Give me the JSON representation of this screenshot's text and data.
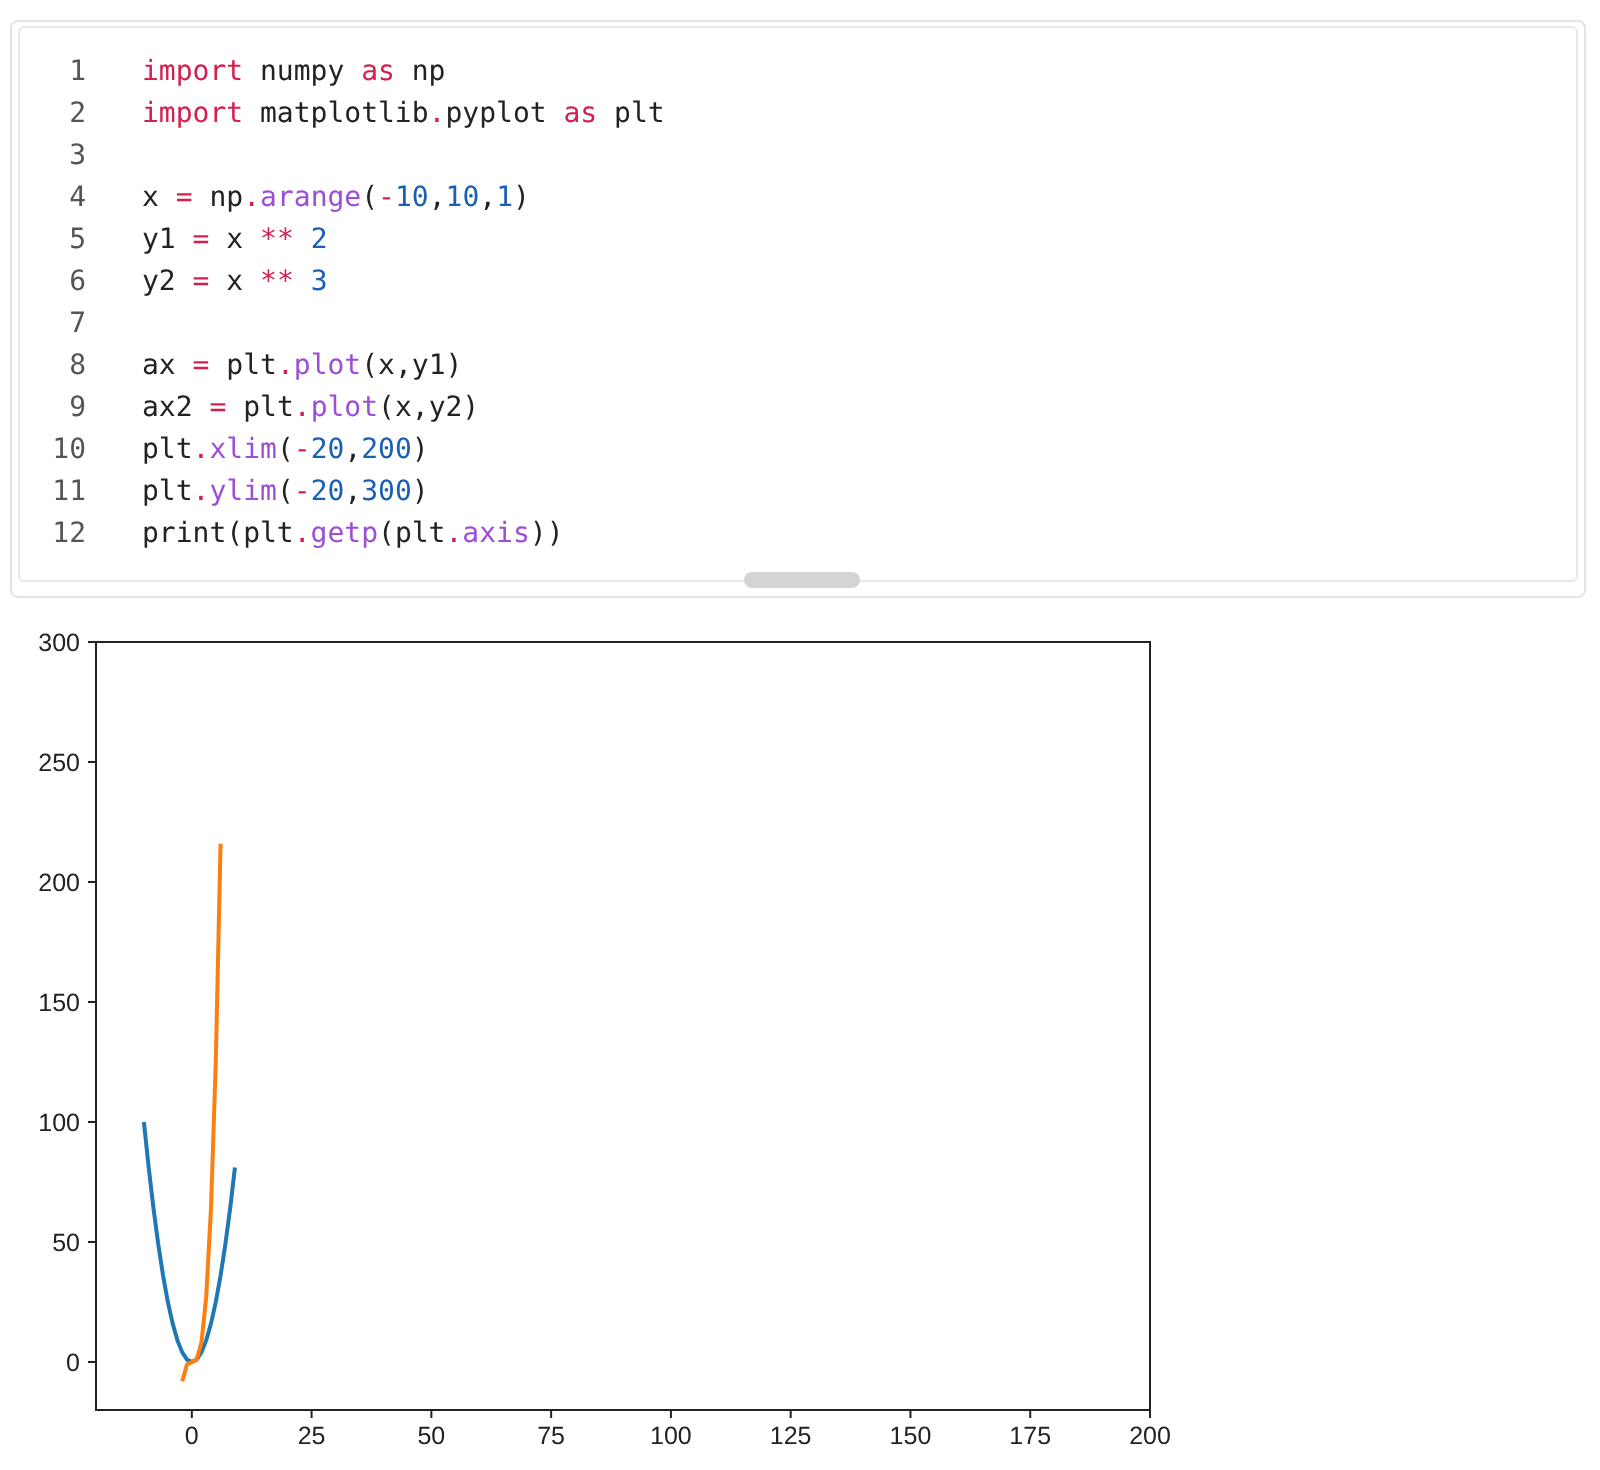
{
  "code_cell": {
    "lines": [
      {
        "number": "1",
        "tokens": [
          {
            "kind": "kw",
            "text": "import"
          },
          {
            "kind": "plain",
            "text": " numpy "
          },
          {
            "kind": "kw",
            "text": "as"
          },
          {
            "kind": "plain",
            "text": " np"
          }
        ]
      },
      {
        "number": "2",
        "tokens": [
          {
            "kind": "kw",
            "text": "import"
          },
          {
            "kind": "plain",
            "text": " matplotlib"
          },
          {
            "kind": "op",
            "text": "."
          },
          {
            "kind": "plain",
            "text": "pyplot "
          },
          {
            "kind": "kw",
            "text": "as"
          },
          {
            "kind": "plain",
            "text": " plt"
          }
        ]
      },
      {
        "number": "3"
      },
      {
        "number": "4",
        "tokens": [
          {
            "kind": "plain",
            "text": "x "
          },
          {
            "kind": "op",
            "text": "="
          },
          {
            "kind": "plain",
            "text": " np"
          },
          {
            "kind": "op",
            "text": "."
          },
          {
            "kind": "fn",
            "text": "arange"
          },
          {
            "kind": "plain",
            "text": "("
          },
          {
            "kind": "op",
            "text": "-"
          },
          {
            "kind": "num",
            "text": "10"
          },
          {
            "kind": "plain",
            "text": ","
          },
          {
            "kind": "num",
            "text": "10"
          },
          {
            "kind": "plain",
            "text": ","
          },
          {
            "kind": "num",
            "text": "1"
          },
          {
            "kind": "plain",
            "text": ")"
          }
        ]
      },
      {
        "number": "5",
        "tokens": [
          {
            "kind": "plain",
            "text": "y1 "
          },
          {
            "kind": "op",
            "text": "="
          },
          {
            "kind": "plain",
            "text": " x "
          },
          {
            "kind": "op",
            "text": "**"
          },
          {
            "kind": "num",
            "text": " 2"
          }
        ]
      },
      {
        "number": "6",
        "tokens": [
          {
            "kind": "plain",
            "text": "y2 "
          },
          {
            "kind": "op",
            "text": "="
          },
          {
            "kind": "plain",
            "text": " x "
          },
          {
            "kind": "op",
            "text": "**"
          },
          {
            "kind": "num",
            "text": " 3"
          }
        ]
      },
      {
        "number": "7"
      },
      {
        "number": "8",
        "tokens": [
          {
            "kind": "plain",
            "text": "ax "
          },
          {
            "kind": "op",
            "text": "="
          },
          {
            "kind": "plain",
            "text": " plt"
          },
          {
            "kind": "op",
            "text": "."
          },
          {
            "kind": "fn",
            "text": "plot"
          },
          {
            "kind": "plain",
            "text": "(x,y1)"
          }
        ]
      },
      {
        "number": "9",
        "tokens": [
          {
            "kind": "plain",
            "text": "ax2 "
          },
          {
            "kind": "op",
            "text": "="
          },
          {
            "kind": "plain",
            "text": " plt"
          },
          {
            "kind": "op",
            "text": "."
          },
          {
            "kind": "fn",
            "text": "plot"
          },
          {
            "kind": "plain",
            "text": "(x,y2)"
          }
        ]
      },
      {
        "number": "10",
        "tokens": [
          {
            "kind": "plain",
            "text": "plt"
          },
          {
            "kind": "op",
            "text": "."
          },
          {
            "kind": "fn",
            "text": "xlim"
          },
          {
            "kind": "plain",
            "text": "("
          },
          {
            "kind": "op",
            "text": "-"
          },
          {
            "kind": "num",
            "text": "20"
          },
          {
            "kind": "plain",
            "text": ","
          },
          {
            "kind": "num",
            "text": "200"
          },
          {
            "kind": "plain",
            "text": ")"
          }
        ]
      },
      {
        "number": "11",
        "tokens": [
          {
            "kind": "plain",
            "text": "plt"
          },
          {
            "kind": "op",
            "text": "."
          },
          {
            "kind": "fn",
            "text": "ylim"
          },
          {
            "kind": "plain",
            "text": "("
          },
          {
            "kind": "op",
            "text": "-"
          },
          {
            "kind": "num",
            "text": "20"
          },
          {
            "kind": "plain",
            "text": ","
          },
          {
            "kind": "num",
            "text": "300"
          },
          {
            "kind": "plain",
            "text": ")"
          }
        ]
      },
      {
        "number": "12",
        "tokens": [
          {
            "kind": "plain",
            "text": "print(plt"
          },
          {
            "kind": "op",
            "text": "."
          },
          {
            "kind": "fn",
            "text": "getp"
          },
          {
            "kind": "plain",
            "text": "(plt"
          },
          {
            "kind": "op",
            "text": "."
          },
          {
            "kind": "fn",
            "text": "axis"
          },
          {
            "kind": "plain",
            "text": "))"
          }
        ]
      }
    ]
  },
  "output": {
    "chart_data": {
      "type": "line",
      "x": [
        -10,
        -9,
        -8,
        -7,
        -6,
        -5,
        -4,
        -3,
        -2,
        -1,
        0,
        1,
        2,
        3,
        4,
        5,
        6,
        7,
        8,
        9
      ],
      "series": [
        {
          "color": "#1f77b4",
          "values": [
            100,
            81,
            64,
            49,
            36,
            25,
            16,
            9,
            4,
            1,
            0,
            1,
            4,
            9,
            16,
            25,
            36,
            49,
            64,
            81
          ]
        },
        {
          "color": "#ff7f0e",
          "values": [
            null,
            null,
            null,
            null,
            null,
            null,
            null,
            null,
            -8,
            -1,
            0,
            1,
            8,
            27,
            64,
            125,
            216,
            null,
            null,
            null
          ]
        }
      ],
      "xlim": [
        -20,
        200
      ],
      "ylim": [
        -20,
        300
      ],
      "xticks": [
        0,
        25,
        50,
        75,
        100,
        125,
        150,
        175,
        200
      ],
      "yticks": [
        0,
        50,
        100,
        150,
        200,
        250,
        300
      ]
    }
  }
}
